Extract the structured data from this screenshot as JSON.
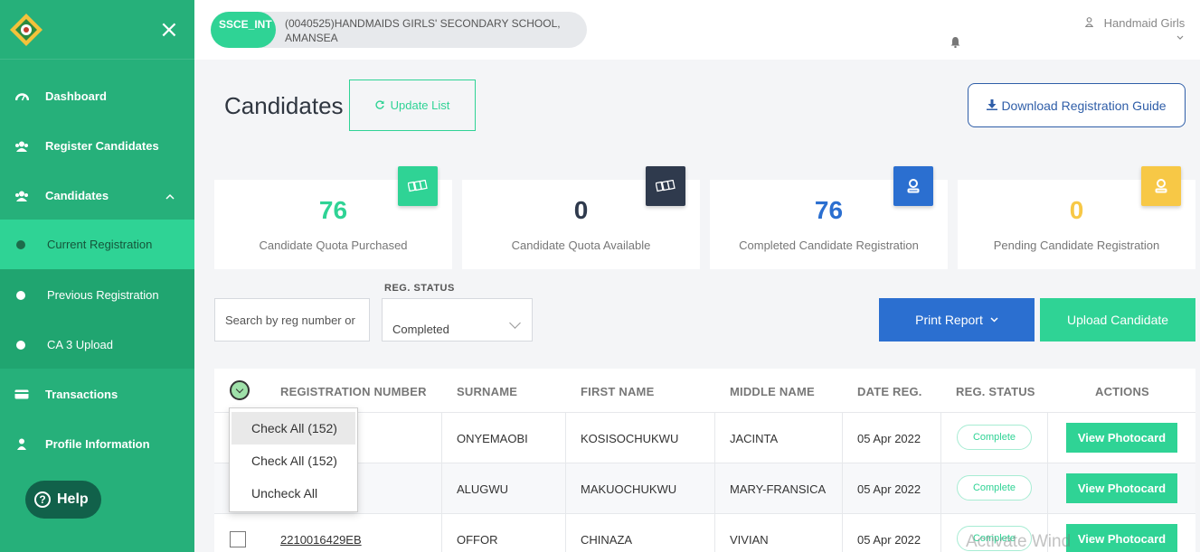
{
  "sidebar": {
    "close_glyph": "×",
    "items": [
      {
        "label": "Dashboard",
        "icon": "gauge-icon"
      },
      {
        "label": "Register Candidates",
        "icon": "users-icon"
      },
      {
        "label": "Candidates",
        "icon": "users-icon",
        "expanded": true
      },
      {
        "label": "Current Registration",
        "icon": "dot",
        "active": true
      },
      {
        "label": "Previous Registration",
        "icon": "dot"
      },
      {
        "label": "CA 3 Upload",
        "icon": "dot"
      },
      {
        "label": "Transactions",
        "icon": "card-icon"
      },
      {
        "label": "Profile Information",
        "icon": "user-icon"
      }
    ],
    "help_label": "Help"
  },
  "topbar": {
    "exam_code": "SSCE_INT",
    "school": "(0040525)HANDMAIDS GIRLS' SECONDARY SCHOOL, AMANSEA",
    "user_name": "Handmaid Girls"
  },
  "page": {
    "title": "Candidates",
    "update_label": "Update List",
    "download_label": "Download Registration Guide"
  },
  "stats": [
    {
      "value": "76",
      "caption": "Candidate Quota Purchased",
      "color": "#2fd395",
      "icon_bg": "#2fd395"
    },
    {
      "value": "0",
      "caption": "Candidate Quota Available",
      "color": "#2f3a4d",
      "icon_bg": "#2f3a4d"
    },
    {
      "value": "76",
      "caption": "Completed Candidate Registration",
      "color": "#2b6fd0",
      "icon_bg": "#2b6fd0"
    },
    {
      "value": "0",
      "caption": "Pending Candidate Registration",
      "color": "#f7c846",
      "icon_bg": "#f7c846"
    }
  ],
  "filters": {
    "search_placeholder": "Search by reg number or",
    "status_label": "REG. STATUS",
    "status_value": "Completed",
    "print_label": "Print Report",
    "upload_label": "Upload Candidate"
  },
  "table": {
    "headers": [
      "REGISTRATION NUMBER",
      "SURNAME",
      "FIRST NAME",
      "MIDDLE NAME",
      "DATE REG.",
      "REG. STATUS",
      "ACTIONS"
    ],
    "rows": [
      {
        "reg": "",
        "surname": "ONYEMAOBI",
        "first": "KOSISOCHUKWU",
        "middle": "JACINTA",
        "date": "05 Apr 2022",
        "status": "Complete",
        "action": "View Photocard"
      },
      {
        "reg": "",
        "surname": "ALUGWU",
        "first": "MAKUOCHUKWU",
        "middle": "MARY-FRANSICA",
        "date": "05 Apr 2022",
        "status": "Complete",
        "action": "View Photocard"
      },
      {
        "reg": "2210016429EB",
        "surname": "OFFOR",
        "first": "CHINAZA",
        "middle": "VIVIAN",
        "date": "05 Apr 2022",
        "status": "Complete",
        "action": "View Photocard"
      }
    ]
  },
  "dropdown": {
    "items": [
      "Check All (152)",
      "Check All (152)",
      "Uncheck All"
    ]
  },
  "watermark": "Activate Wind"
}
